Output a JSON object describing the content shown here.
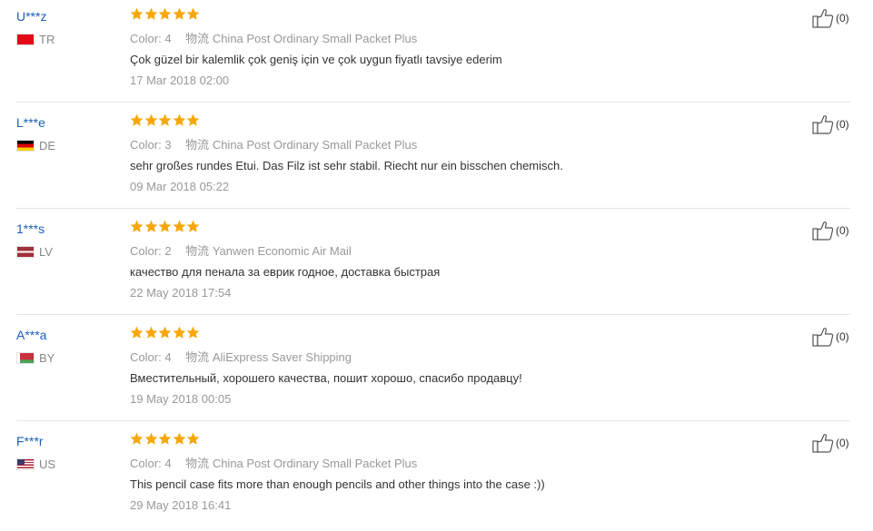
{
  "reviews": [
    {
      "user": "U***z",
      "country": "TR",
      "flag": "turkey",
      "rating": 5,
      "color_label": "Color:",
      "color_value": "4",
      "shipping_label": "物流",
      "shipping": "China Post Ordinary Small Packet Plus",
      "text": "Çok güzel bir kalemlik çok geniş için ve çok uygun fiyatlı tavsiye ederim",
      "date": "17 Mar 2018 02:00",
      "helpful": "(0)"
    },
    {
      "user": "L***e",
      "country": "DE",
      "flag": "germany",
      "rating": 5,
      "color_label": "Color:",
      "color_value": "3",
      "shipping_label": "物流",
      "shipping": "China Post Ordinary Small Packet Plus",
      "text": "sehr großes rundes Etui. Das Filz ist sehr stabil. Riecht nur ein bisschen chemisch.",
      "date": "09 Mar 2018 05:22",
      "helpful": "(0)"
    },
    {
      "user": "1***s",
      "country": "LV",
      "flag": "latvia",
      "rating": 5,
      "color_label": "Color:",
      "color_value": "2",
      "shipping_label": "物流",
      "shipping": "Yanwen Economic Air Mail",
      "text": "качество для пенала за еврик годное, доставка быстрая",
      "date": "22 May 2018 17:54",
      "helpful": "(0)"
    },
    {
      "user": "A***a",
      "country": "BY",
      "flag": "belarus",
      "rating": 5,
      "color_label": "Color:",
      "color_value": "4",
      "shipping_label": "物流",
      "shipping": "AliExpress Saver Shipping",
      "text": "Вместительный, хорошего качества, пошит хорошо, спасибо продавцу!",
      "date": "19 May 2018 00:05",
      "helpful": "(0)"
    },
    {
      "user": "F***r",
      "country": "US",
      "flag": "usa",
      "rating": 5,
      "color_label": "Color:",
      "color_value": "4",
      "shipping_label": "物流",
      "shipping": "China Post Ordinary Small Packet Plus",
      "text": "This pencil case fits more than enough pencils and other things into the case :))",
      "date": "29 May 2018 16:41",
      "helpful": "(0)"
    }
  ],
  "colors": {
    "username": "#1a60b8",
    "star": "#f7a70a",
    "muted": "#999999",
    "divider": "#e6e6e6"
  }
}
